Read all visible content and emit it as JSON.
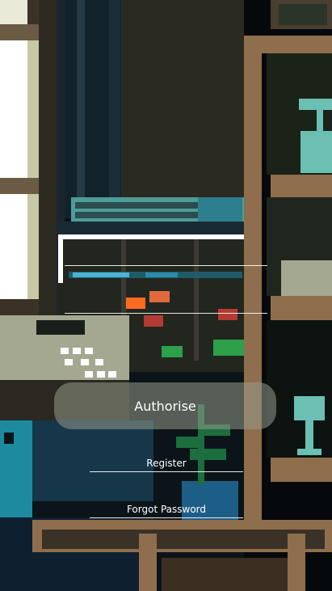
{
  "form": {
    "username_value": "",
    "password_value": "",
    "authorise_label": "Authorise",
    "register_label": "Register",
    "forgot_label": "Forgot Password"
  }
}
